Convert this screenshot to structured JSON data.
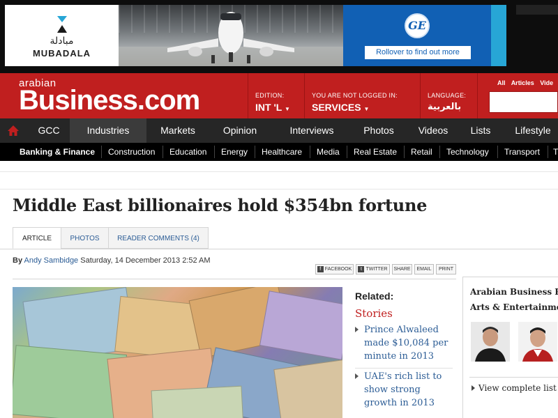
{
  "ad": {
    "mubadala_arabic": "مبادلة",
    "mubadala_latin": "MUBADALA",
    "ge_logo": "GE",
    "ge_button": "Rollover to find out more"
  },
  "header": {
    "logo_small": "arabian",
    "logo_big": "Business.com",
    "edition_label": "EDITION:",
    "edition_value": "INT 'L",
    "login_label": "YOU ARE NOT LOGGED IN:",
    "login_value": "SERVICES",
    "language_label": "LANGUAGE:",
    "language_value": "بالعربية",
    "search_filters": [
      "All",
      "Articles",
      "Vide"
    ]
  },
  "nav": {
    "items": [
      "GCC",
      "Industries",
      "Markets",
      "Opinion",
      "Interviews",
      "Photos",
      "Videos",
      "Lists",
      "Lifestyle"
    ]
  },
  "subnav": {
    "items": [
      "Banking & Finance",
      "Construction",
      "Education",
      "Energy",
      "Healthcare",
      "Media",
      "Real Estate",
      "Retail",
      "Technology",
      "Transport",
      "T"
    ]
  },
  "article": {
    "headline": "Middle East billionaires hold $354bn fortune",
    "tabs": [
      "ARTICLE",
      "PHOTOS",
      "READER COMMENTS (4)"
    ],
    "by": "By",
    "author": "Andy Sambidge",
    "date": "Saturday, 14 December 2013 2:52 AM",
    "share": [
      "FACEBOOK",
      "TWITTER",
      "SHARE",
      "EMAIL",
      "PRINT"
    ]
  },
  "related": {
    "label": "Related:",
    "stories_label": "Stories",
    "items": [
      "Prince Alwaleed made $10,084 per minute in 2013",
      "UAE's rich list to show strong growth in 2013"
    ]
  },
  "sidebar": {
    "title_line1": "Arabian Business Pow",
    "title_line2": "Arts & Entertainment",
    "view_list": "View complete list"
  },
  "colors": {
    "brand_red": "#c01f1f",
    "nav_dark": "#262626",
    "link_blue": "#2b5c95",
    "ge_blue": "#1160b4"
  }
}
